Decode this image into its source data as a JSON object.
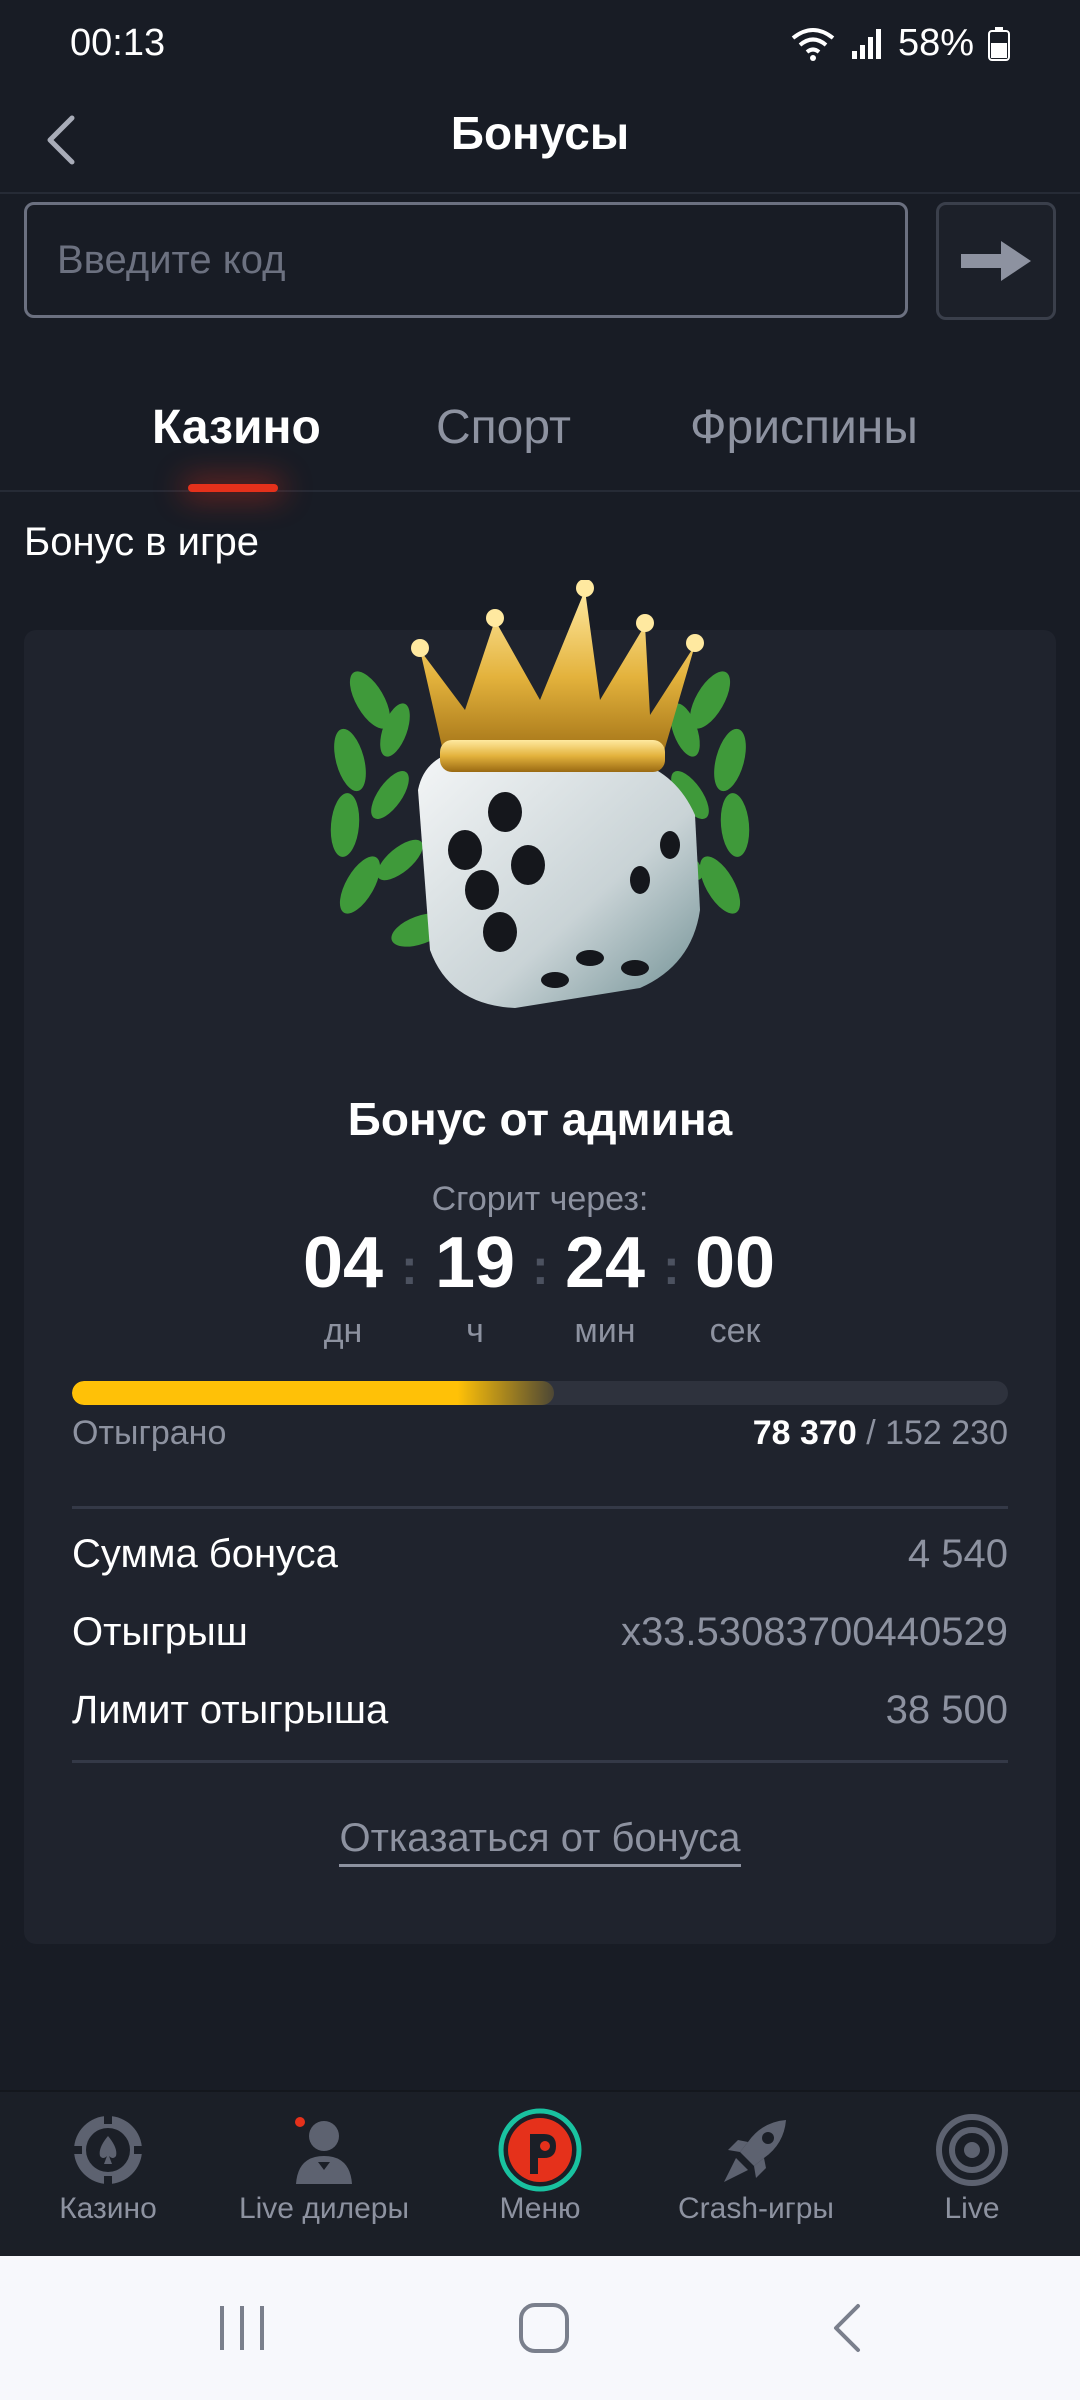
{
  "status_bar": {
    "time": "00:13",
    "battery": "58%"
  },
  "header": {
    "title": "Бонусы"
  },
  "code": {
    "placeholder": "Введите код"
  },
  "tabs": [
    {
      "label": "Казино",
      "active": true
    },
    {
      "label": "Спорт",
      "active": false
    },
    {
      "label": "Фриспины",
      "active": false
    }
  ],
  "section_title": "Бонус в игре",
  "bonus": {
    "name": "Бонус от админа",
    "expires_label": "Сгорит через:",
    "countdown": [
      {
        "value": "04",
        "unit": "дн"
      },
      {
        "value": "19",
        "unit": "ч"
      },
      {
        "value": "24",
        "unit": "мин"
      },
      {
        "value": "00",
        "unit": "сек"
      }
    ],
    "progress": {
      "label": "Отыграно",
      "current": "78 370",
      "total": "/ 152 230",
      "fraction": 0.515,
      "color": "#ffc107"
    },
    "details": [
      {
        "label": "Сумма бонуса",
        "value": "4 540"
      },
      {
        "label": "Отыгрыш",
        "value": "x33.53083700440529"
      },
      {
        "label": "Лимит отыгрыша",
        "value": "38 500"
      }
    ],
    "refuse_label": "Отказаться от бонуса"
  },
  "bottom_nav": [
    {
      "label": "Казино",
      "icon": "casino-chip-icon"
    },
    {
      "label": "Live дилеры",
      "icon": "live-dealer-icon"
    },
    {
      "label": "Меню",
      "icon": "menu-logo-icon"
    },
    {
      "label": "Crash-игры",
      "icon": "rocket-icon"
    },
    {
      "label": "Live",
      "icon": "live-target-icon"
    }
  ],
  "colors": {
    "background": "#181c25",
    "card": "#1f232d",
    "accent": "#e5311b",
    "progress": "#ffc107",
    "menu_ring": "#19c2a0"
  }
}
